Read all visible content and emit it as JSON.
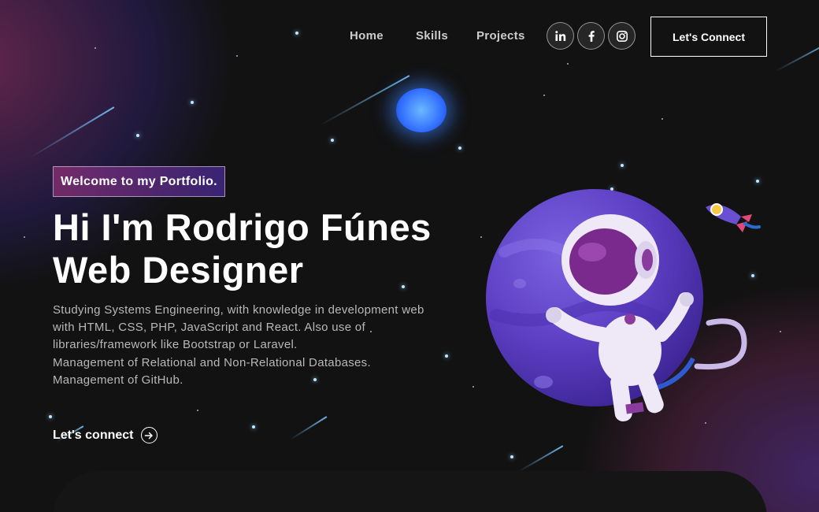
{
  "nav": {
    "links": [
      "Home",
      "Skills",
      "Projects"
    ],
    "social": [
      "linkedin-icon",
      "facebook-icon",
      "instagram-icon"
    ],
    "connect_label": "Let's Connect"
  },
  "hero": {
    "tagline": "Welcome to my Portfolio.",
    "title_line1": "Hi I'm Rodrigo Fúnes",
    "title_line2": "Web Designer",
    "description": [
      "Studying Systems Engineering, with knowledge in development web",
      "with HTML, CSS, PHP, JavaScript and React. Also use of",
      "libraries/framework like Bootstrap or Laravel.",
      "Management of Relational and Non-Relational Databases.",
      "Management of GitHub."
    ],
    "cta_label": "Let's connect",
    "cta_icon": "arrow-right-circle-icon"
  },
  "colors": {
    "background": "#121212",
    "gradient_start": "#AA367C",
    "gradient_end": "#4A2FBD",
    "text_muted": "#B8B8B8"
  }
}
